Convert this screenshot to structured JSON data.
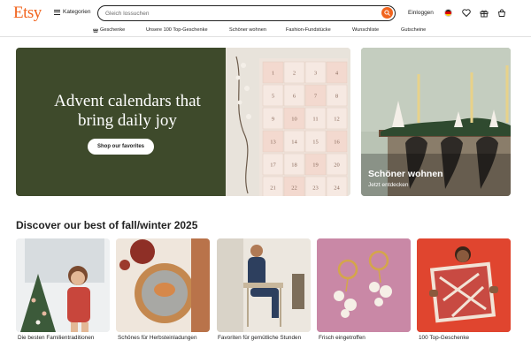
{
  "header": {
    "logo": "Etsy",
    "categories_label": "Kategorien",
    "search_placeholder": "Gleich lossuchen",
    "signin_label": "Einloggen",
    "accent_color": "#f1641e"
  },
  "nav": {
    "items": [
      {
        "label": "Geschenke",
        "icon": "gift-icon"
      },
      {
        "label": "Unsere 100 Top-Geschenke"
      },
      {
        "label": "Schöner wohnen"
      },
      {
        "label": "Fashion-Fundstücke"
      },
      {
        "label": "Wunschliste"
      },
      {
        "label": "Gutscheine"
      }
    ]
  },
  "hero": {
    "title": "Advent calendars that bring daily joy",
    "button_label": "Shop our favorites",
    "background_color": "#3e4a2b",
    "calendar_numbers": [
      "1",
      "2",
      "3",
      "4",
      "5",
      "6",
      "7",
      "8",
      "9",
      "10",
      "11",
      "12",
      "13",
      "14",
      "15",
      "16",
      "17",
      "18",
      "19",
      "20",
      "21",
      "22",
      "23",
      "24"
    ]
  },
  "home_card": {
    "title": "Schöner wohnen",
    "subtitle": "Jetzt entdecken"
  },
  "section": {
    "title": "Discover our best of fall/winter 2025",
    "tiles": [
      {
        "label": "Die besten Familientraditionen"
      },
      {
        "label": "Schönes für Herbsteinladungen"
      },
      {
        "label": "Favoriten für gemütliche Stunden"
      },
      {
        "label": "Frisch eingetroffen"
      },
      {
        "label": "100 Top-Geschenke"
      }
    ]
  }
}
